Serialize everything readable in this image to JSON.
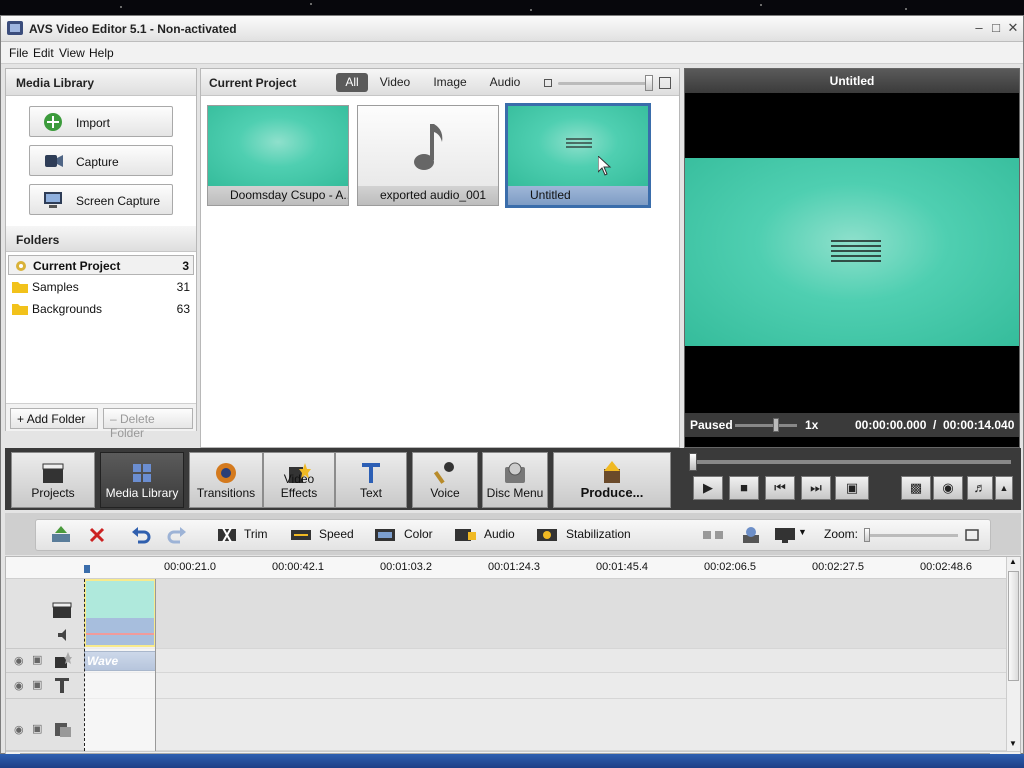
{
  "window": {
    "title": "AVS Video Editor 5.1 - Non-activated"
  },
  "menu": [
    "File",
    "Edit",
    "View",
    "Help"
  ],
  "media_library": {
    "title": "Media Library",
    "buttons": [
      "Import",
      "Capture",
      "Screen Capture"
    ],
    "folders_title": "Folders",
    "folders": [
      {
        "name": "Current Project",
        "count": "3"
      },
      {
        "name": "Samples",
        "count": "31"
      },
      {
        "name": "Backgrounds",
        "count": "63"
      }
    ],
    "add_folder": "Add Folder",
    "delete_folder": "Delete Folder"
  },
  "project": {
    "title": "Current Project",
    "filters": [
      "All",
      "Video",
      "Image",
      "Audio"
    ],
    "active_filter": "All",
    "items": [
      {
        "name": "Doomsday Csupo - A...",
        "kind": "video"
      },
      {
        "name": "exported audio_001",
        "kind": "audio"
      },
      {
        "name": "Untitled",
        "kind": "video",
        "selected": true
      }
    ]
  },
  "preview": {
    "title": "Untitled",
    "state": "Paused",
    "speed": "1x",
    "current_time": "00:00:00.000",
    "total_time": "00:00:14.040"
  },
  "modules": [
    "Projects",
    "Media Library",
    "Transitions",
    "Video Effects",
    "Text",
    "Voice",
    "Disc Menu",
    "Produce..."
  ],
  "active_module": "Media Library",
  "toolbar": {
    "items": [
      "Trim",
      "Speed",
      "Color",
      "Audio",
      "Stabilization"
    ],
    "zoom_label": "Zoom:"
  },
  "timeline": {
    "ticks": [
      "00:00:21.0",
      "00:00:42.1",
      "00:01:03.2",
      "00:01:24.3",
      "00:01:45.4",
      "00:02:06.5",
      "00:02:27.5",
      "00:02:48.6"
    ],
    "effect_clip": "Wave"
  },
  "colors": {
    "teal": "#40c6a6",
    "selection": "#3a6dab",
    "dark_bar": "#3a3a3a"
  }
}
